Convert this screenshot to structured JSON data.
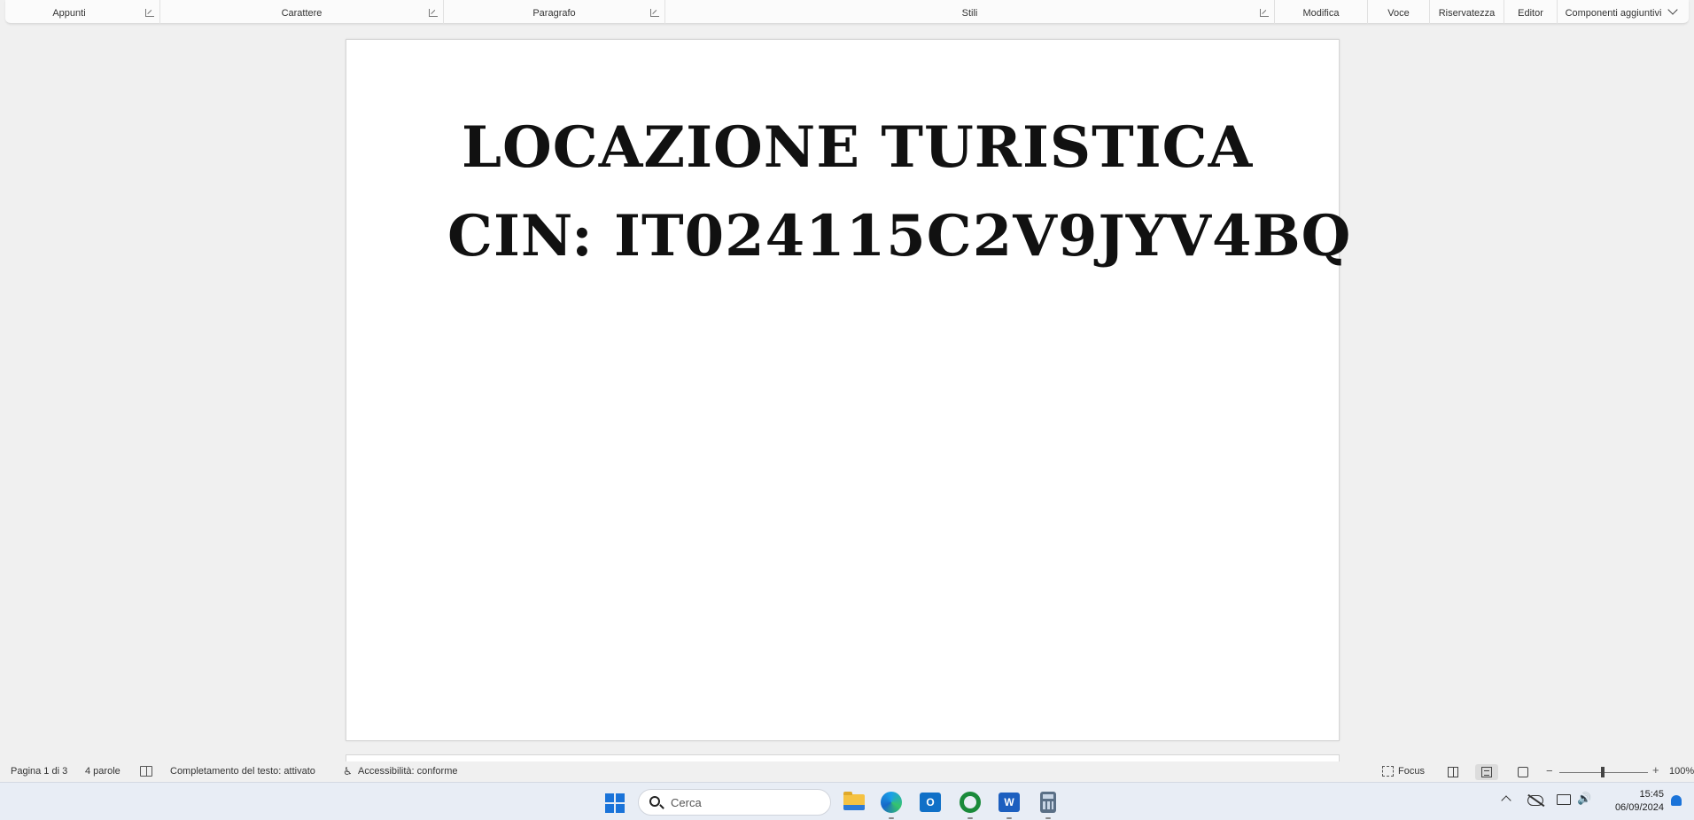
{
  "ribbon": {
    "groups": [
      {
        "label": "Appunti"
      },
      {
        "label": "Carattere"
      },
      {
        "label": "Paragrafo"
      },
      {
        "label": "Stili"
      },
      {
        "label": "Modifica"
      },
      {
        "label": "Voce"
      },
      {
        "label": "Riservatezza"
      },
      {
        "label": "Editor"
      },
      {
        "label": "Componenti aggiuntivi"
      }
    ]
  },
  "document": {
    "line1": "LOCAZIONE TURISTICA",
    "line2": "CIN: IT024115C2V9JYV4BQ"
  },
  "statusbar": {
    "page": "Pagina 1 di 3",
    "words": "4 parole",
    "autocomplete": "Completamento del testo: attivato",
    "accessibility": "Accessibilità: conforme",
    "focus": "Focus",
    "zoom": "100%",
    "zoom_level_percent": 100
  },
  "taskbar": {
    "search_placeholder": "Cerca",
    "outlook_letter": "O",
    "word_letter": "W",
    "volume_glyph": "🔊",
    "time": "15:45",
    "date": "06/09/2024"
  },
  "colors": {
    "accent": "#1a73d9",
    "word_blue": "#1d5fbf"
  }
}
